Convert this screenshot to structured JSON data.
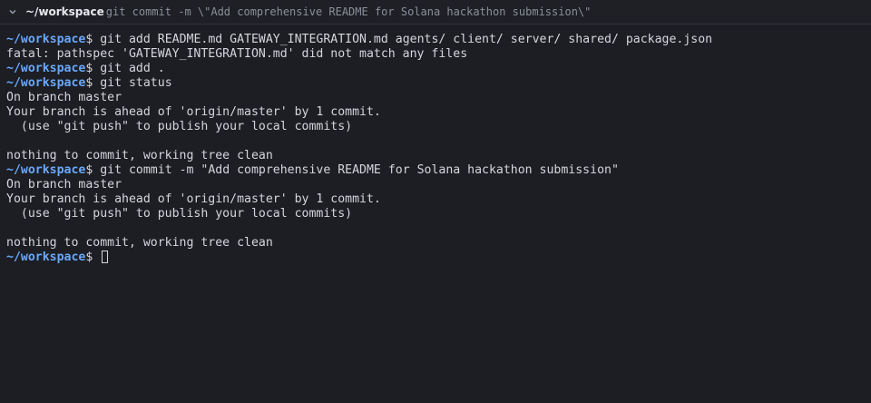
{
  "tab": {
    "name": "~/workspace",
    "command": "git commit -m \\\"Add comprehensive README for Solana hackathon submission\\\""
  },
  "terminal": {
    "prompt_path": "~/workspace",
    "prompt_sign": "$",
    "lines": [
      {
        "type": "cmd",
        "text": "git add README.md GATEWAY_INTEGRATION.md agents/ client/ server/ shared/ package.json"
      },
      {
        "type": "out",
        "text": "fatal: pathspec 'GATEWAY_INTEGRATION.md' did not match any files"
      },
      {
        "type": "cmd",
        "text": "git add ."
      },
      {
        "type": "cmd",
        "text": "git status"
      },
      {
        "type": "out",
        "text": "On branch master"
      },
      {
        "type": "out",
        "text": "Your branch is ahead of 'origin/master' by 1 commit."
      },
      {
        "type": "out",
        "text": "  (use \"git push\" to publish your local commits)"
      },
      {
        "type": "out",
        "text": ""
      },
      {
        "type": "out",
        "text": "nothing to commit, working tree clean"
      },
      {
        "type": "cmd",
        "text": "git commit -m \"Add comprehensive README for Solana hackathon submission\""
      },
      {
        "type": "out",
        "text": "On branch master"
      },
      {
        "type": "out",
        "text": "Your branch is ahead of 'origin/master' by 1 commit."
      },
      {
        "type": "out",
        "text": "  (use \"git push\" to publish your local commits)"
      },
      {
        "type": "out",
        "text": ""
      },
      {
        "type": "out",
        "text": "nothing to commit, working tree clean"
      }
    ]
  },
  "colors": {
    "background": "#1c1e24",
    "prompt": "#6aa8f8",
    "text": "#d4d6dc"
  }
}
